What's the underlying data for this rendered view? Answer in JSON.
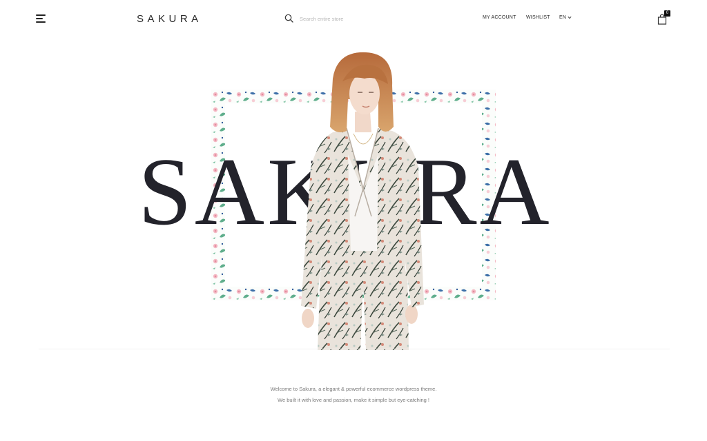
{
  "header": {
    "logo": "SAKURA",
    "search_placeholder": "Search entire store",
    "nav": {
      "account": "MY ACCOUNT",
      "wishlist": "WISHLIST",
      "language": "EN"
    },
    "cart_count": "0"
  },
  "hero": {
    "title": "SAKURA"
  },
  "intro": {
    "line1": "Welcome to Sakura, a elegant & powerful ecommerce wordpress theme.",
    "line2": "We built it with love and passion, make it simple but eye-catching !"
  },
  "icons": {
    "menu": "hamburger-menu-icon",
    "search": "search-icon",
    "language_dropdown": "chevron-down-icon",
    "cart": "shopping-bag-icon"
  },
  "colors": {
    "text_dark": "#23232b",
    "muted_text": "#7a7a7a",
    "placeholder": "#b7b7b7",
    "badge_bg": "#111111"
  }
}
